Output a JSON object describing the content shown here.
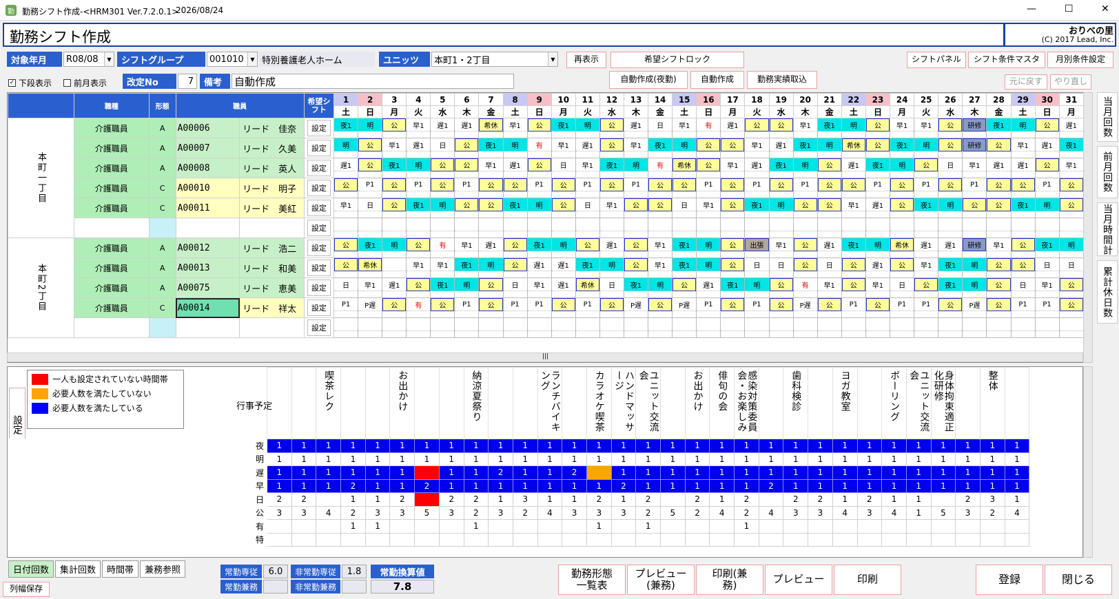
{
  "titlebar": {
    "title": "勤務シフト作成-<HRM301 Ver.7.2.0.1>",
    "date": "2026/08/24",
    "minimize": "—",
    "maximize": "☐",
    "close": "✕",
    "app_icon": "app-icon"
  },
  "header": {
    "title": "勤務シフト作成",
    "brand": "おりべの里",
    "copyright": "(C) 2017 Lead, Inc."
  },
  "filters": {
    "year_month_label": "対象年月",
    "year_month": "R08/08",
    "group_label": "シフトグループ",
    "group_code": "001010",
    "group_name": "特別養護老人ホーム",
    "unit_label": "ユニッツ",
    "unit_value": "本町1・2丁目",
    "show_lower": "下段表示",
    "show_prev": "前月表示",
    "revision_label": "改定No",
    "revision": "7",
    "note_label": "備考",
    "note": "自動作成"
  },
  "buttons": {
    "redisplay": "再表示",
    "request_lock": "希望シフトロック",
    "auto_night": "自動作成(夜勤)",
    "auto": "自動作成",
    "import": "勤務実績取込",
    "shift_panel": "シフトパネル",
    "shift_master": "シフト条件マスタ",
    "monthly_cond": "月別条件設定",
    "undo": "元に戻す",
    "redo": "やり直し"
  },
  "grid": {
    "col_job": "職種",
    "col_form": "形態",
    "col_staff": "職員",
    "col_req": "希望シフト",
    "set_label": "設定",
    "days": [
      [
        "1",
        "土"
      ],
      [
        "2",
        "日"
      ],
      [
        "3",
        "月"
      ],
      [
        "4",
        "火"
      ],
      [
        "5",
        "水"
      ],
      [
        "6",
        "木"
      ],
      [
        "7",
        "金"
      ],
      [
        "8",
        "土"
      ],
      [
        "9",
        "日"
      ],
      [
        "10",
        "月"
      ],
      [
        "11",
        "火"
      ],
      [
        "12",
        "水"
      ],
      [
        "13",
        "木"
      ],
      [
        "14",
        "金"
      ],
      [
        "15",
        "土"
      ],
      [
        "16",
        "日"
      ],
      [
        "17",
        "月"
      ],
      [
        "18",
        "火"
      ],
      [
        "19",
        "水"
      ],
      [
        "20",
        "木"
      ],
      [
        "21",
        "金"
      ],
      [
        "22",
        "土"
      ],
      [
        "23",
        "日"
      ],
      [
        "24",
        "月"
      ],
      [
        "25",
        "火"
      ],
      [
        "26",
        "水"
      ],
      [
        "27",
        "木"
      ],
      [
        "28",
        "金"
      ],
      [
        "29",
        "土"
      ],
      [
        "30",
        "日"
      ],
      [
        "31",
        "月"
      ]
    ],
    "units": [
      {
        "name": "本町一丁目",
        "rows": [
          {
            "job": "介護職員",
            "form": "A",
            "id": "A00006",
            "name": "リード　佳奈",
            "shifts": [
              "夜1",
              "明",
              "公",
              "早1",
              "遅1",
              "遅1",
              "希休",
              "早1",
              "公",
              "夜1",
              "明",
              "公",
              "遅1",
              "日",
              "早1",
              "有",
              "遅1",
              "公",
              "公",
              "早1",
              "夜1",
              "明",
              "公",
              "早1",
              "早1",
              "公",
              "研修",
              "夜1",
              "明",
              "公",
              "遅1"
            ]
          },
          {
            "job": "介護職員",
            "form": "A",
            "id": "A00007",
            "name": "リード　久美",
            "shifts": [
              "明",
              "公",
              "早1",
              "遅1",
              "日",
              "公",
              "夜1",
              "明",
              "有",
              "早1",
              "遅1",
              "公",
              "早1",
              "夜1",
              "明",
              "公",
              "公",
              "早1",
              "遅1",
              "夜1",
              "明",
              "希休",
              "公",
              "夜1",
              "明",
              "公",
              "研修",
              "公",
              "早1",
              "遅1",
              "夜1"
            ]
          },
          {
            "job": "介護職員",
            "form": "A",
            "id": "A00008",
            "name": "リード　英人",
            "shifts": [
              "遅1",
              "公",
              "夜1",
              "明",
              "公",
              "公",
              "早1",
              "遅1",
              "公",
              "日",
              "早1",
              "夜1",
              "明",
              "有",
              "希休",
              "公",
              "早1",
              "遅1",
              "夜1",
              "明",
              "公",
              "遅1",
              "夜1",
              "明",
              "公",
              "日",
              "早1",
              "遅1",
              "遅1",
              "公",
              "早1"
            ]
          },
          {
            "job": "介護職員",
            "form": "C",
            "id": "A00010",
            "name": "リード　明子",
            "shifts": [
              "公",
              "P1",
              "公",
              "P1",
              "公",
              "P1",
              "公",
              "公",
              "P1",
              "公",
              "P1",
              "公",
              "P1",
              "公",
              "公",
              "P1",
              "公",
              "P1",
              "公",
              "P1",
              "公",
              "公",
              "P1",
              "公",
              "P1",
              "公",
              "P1",
              "公",
              "公",
              "P1",
              "公"
            ]
          },
          {
            "job": "介護職員",
            "form": "C",
            "id": "A00011",
            "name": "リード　美紅",
            "shifts": [
              "早1",
              "日",
              "公",
              "夜1",
              "明",
              "公",
              "公",
              "夜1",
              "明",
              "公",
              "日",
              "早1",
              "公",
              "公",
              "日",
              "早1",
              "公",
              "夜1",
              "明",
              "公",
              "公",
              "早1",
              "遅1",
              "公",
              "夜1",
              "明",
              "公",
              "公",
              "夜1",
              "明",
              "公"
            ]
          },
          {
            "job": "",
            "form": "",
            "id": "",
            "name": "",
            "shifts": []
          }
        ]
      },
      {
        "name": "本町2丁目",
        "rows": [
          {
            "job": "介護職員",
            "form": "A",
            "id": "A00012",
            "name": "リード　浩二",
            "shifts": [
              "公",
              "夜1",
              "明",
              "公",
              "有",
              "早1",
              "遅1",
              "公",
              "夜1",
              "明",
              "公",
              "遅1",
              "公",
              "早1",
              "夜1",
              "明",
              "公",
              "出張",
              "早1",
              "公",
              "遅1",
              "夜1",
              "明",
              "希休",
              "遅1",
              "遅1",
              "研修",
              "早1",
              "公",
              "夜1",
              "明"
            ]
          },
          {
            "job": "介護職員",
            "form": "A",
            "id": "A00013",
            "name": "リード　和美",
            "shifts": [
              "公",
              "希休",
              "",
              "早1",
              "早1",
              "夜1",
              "明",
              "公",
              "遅1",
              "遅1",
              "夜1",
              "明",
              "公",
              "早1",
              "夜1",
              "明",
              "公",
              "日",
              "日",
              "公",
              "日",
              "公",
              "遅1",
              "公",
              "早1",
              "夜1",
              "明",
              "公",
              "公",
              "日",
              "日"
            ]
          },
          {
            "job": "介護職員",
            "form": "A",
            "id": "A00075",
            "name": "リード　恵美",
            "shifts": [
              "日",
              "早1",
              "遅1",
              "公",
              "夜1",
              "明",
              "公",
              "日",
              "早1",
              "遅1",
              "希休",
              "日",
              "夜1",
              "明",
              "公",
              "遅1",
              "夜1",
              "明",
              "公",
              "有",
              "早1",
              "公",
              "早1",
              "日",
              "公",
              "夜1",
              "明",
              "公",
              "日",
              "早1",
              "公"
            ]
          },
          {
            "job": "介護職員",
            "form": "C",
            "id": "A00014",
            "name": "リード　祥太",
            "shifts": [
              "P1",
              "P遅",
              "公",
              "有",
              "公",
              "P1",
              "公",
              "P1",
              "P1",
              "公",
              "P1",
              "公",
              "P遅",
              "公",
              "P遅",
              "P1",
              "公",
              "P1",
              "公",
              "P遅",
              "公",
              "P1",
              "公",
              "P1",
              "P1",
              "公",
              "P遅",
              "公",
              "P1",
              "P1",
              "公"
            ]
          },
          {
            "job": "",
            "form": "",
            "id": "",
            "name": "",
            "shifts": []
          }
        ]
      }
    ]
  },
  "legend": {
    "setting": "設定",
    "items": [
      {
        "color": "#ff0000",
        "text": "一人も設定されていない時間帯"
      },
      {
        "color": "#ffa500",
        "text": "必要人数を満たしていない"
      },
      {
        "color": "#0000ff",
        "text": "必要人数を満たしている"
      }
    ]
  },
  "events_label": "行事予定",
  "events": [
    "",
    "",
    "",
    "",
    "喫茶レク",
    "",
    "",
    "お出かけ",
    "",
    "",
    "納涼夏祭り",
    "",
    "",
    "ランチバイキング",
    "",
    "カラオケ喫茶",
    "ハンドマッサージ",
    "ユニット交流会",
    "",
    "お出かけ",
    "俳句の会",
    "感染対策委員会・お楽しみ",
    "",
    "歯科検診",
    "",
    "ヨガ教室",
    "",
    "ボーリング",
    "ユニット交流会",
    "身体拘束適正化研修",
    "",
    "整体",
    "",
    ""
  ],
  "summary": [
    {
      "label": "夜",
      "values": [
        "1",
        "1",
        "1",
        "1",
        "1",
        "1",
        "1",
        "1",
        "1",
        "1",
        "1",
        "1",
        "1",
        "1",
        "1",
        "1",
        "1",
        "1",
        "1",
        "1",
        "1",
        "1",
        "1",
        "1",
        "1",
        "1",
        "1",
        "1",
        "1",
        "1",
        "1"
      ]
    },
    {
      "label": "明",
      "values": [
        "1",
        "1",
        "1",
        "1",
        "1",
        "1",
        "1",
        "1",
        "1",
        "1",
        "1",
        "1",
        "1",
        "1",
        "1",
        "1",
        "1",
        "1",
        "1",
        "1",
        "1",
        "1",
        "1",
        "1",
        "1",
        "1",
        "1",
        "1",
        "1",
        "1",
        "1"
      ]
    },
    {
      "label": "遅",
      "values": [
        "1",
        "1",
        "1",
        "1",
        "1",
        "1",
        "",
        "1",
        "1",
        "2",
        "1",
        "1",
        "2",
        "",
        "1",
        "1",
        "1",
        "1",
        "1",
        "1",
        "1",
        "1",
        "1",
        "1",
        "1",
        "1",
        "1",
        "1",
        "1",
        "1",
        "1"
      ]
    },
    {
      "label": "早",
      "values": [
        "1",
        "1",
        "1",
        "2",
        "1",
        "1",
        "2",
        "1",
        "1",
        "1",
        "1",
        "1",
        "1",
        "1",
        "2",
        "1",
        "1",
        "1",
        "1",
        "1",
        "2",
        "1",
        "1",
        "1",
        "1",
        "1",
        "1",
        "1",
        "1",
        "1",
        "1"
      ]
    },
    {
      "label": "日",
      "values": [
        "2",
        "2",
        "",
        "1",
        "1",
        "2",
        "",
        "2",
        "2",
        "1",
        "3",
        "1",
        "1",
        "2",
        "1",
        "2",
        "",
        "2",
        "1",
        "2",
        "",
        "2",
        "2",
        "1",
        "2",
        "1",
        "1",
        "",
        "2",
        "3",
        "1"
      ]
    },
    {
      "label": "公",
      "values": [
        "3",
        "3",
        "4",
        "2",
        "3",
        "3",
        "5",
        "3",
        "2",
        "3",
        "2",
        "4",
        "3",
        "3",
        "3",
        "2",
        "5",
        "2",
        "4",
        "2",
        "4",
        "3",
        "3",
        "4",
        "3",
        "4",
        "1",
        "5",
        "3",
        "2",
        "4"
      ]
    },
    {
      "label": "有",
      "values": [
        "",
        "",
        "",
        "1",
        "1",
        "",
        "",
        "",
        "1",
        "",
        "",
        "",
        "",
        "1",
        "",
        "1",
        "",
        "",
        "",
        "1",
        "",
        "",
        "",
        "",
        "",
        "",
        "",
        "",
        "",
        "",
        ""
      ]
    },
    {
      "label": "特",
      "values": [
        "",
        "",
        "",
        "",
        "",
        "",
        "",
        "",
        "",
        "",
        "",
        "",
        "",
        "",
        "",
        "",
        "",
        "",
        "",
        "",
        "",
        "",
        "",
        "",
        "",
        "",
        "",
        "",
        "",
        "",
        ""
      ]
    }
  ],
  "right_tabs": [
    "当月回数",
    "前月回数",
    "当月時間計",
    "累計休日数"
  ],
  "bottom": {
    "tabs": [
      "日付回数",
      "集計回数",
      "時間帯",
      "兼務参照"
    ],
    "save_width": "列幅保存",
    "ft_label": "常勤専従",
    "ft_value": "6.0",
    "pt_label": "非常勤専従",
    "pt_value": "1.8",
    "conv_label": "常勤換算値",
    "ft_multi": "常勤兼務",
    "pt_multi": "非常勤兼務",
    "conv_value": "7.8",
    "b1": "勤務形態一覧表",
    "b2": "プレビュー(兼務)",
    "b3": "印刷(兼務)",
    "b4": "プレビュー",
    "b5": "印刷",
    "register": "登録",
    "close": "閉じる"
  },
  "colors": {
    "night": "#00e5e5",
    "off": "#ffff99",
    "red_day": "#f7c0c8",
    "sat": "#c8c8f5",
    "training": "#8a9ac8",
    "trip": "#b0a89a",
    "blue": "#0000ee",
    "red": "#ff0000",
    "orange": "#ffa500"
  }
}
